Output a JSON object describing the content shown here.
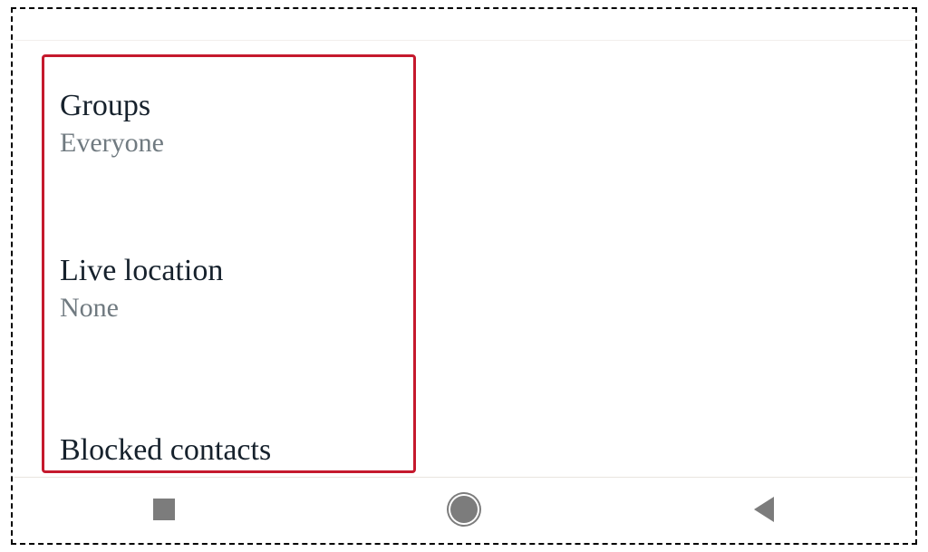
{
  "settings": {
    "groups": {
      "title": "Groups",
      "value": "Everyone"
    },
    "live_location": {
      "title": "Live location",
      "value": "None"
    },
    "blocked_contacts": {
      "title": "Blocked contacts"
    }
  },
  "nav": {
    "recents": "recents-icon",
    "home": "home-icon",
    "back": "back-icon"
  }
}
